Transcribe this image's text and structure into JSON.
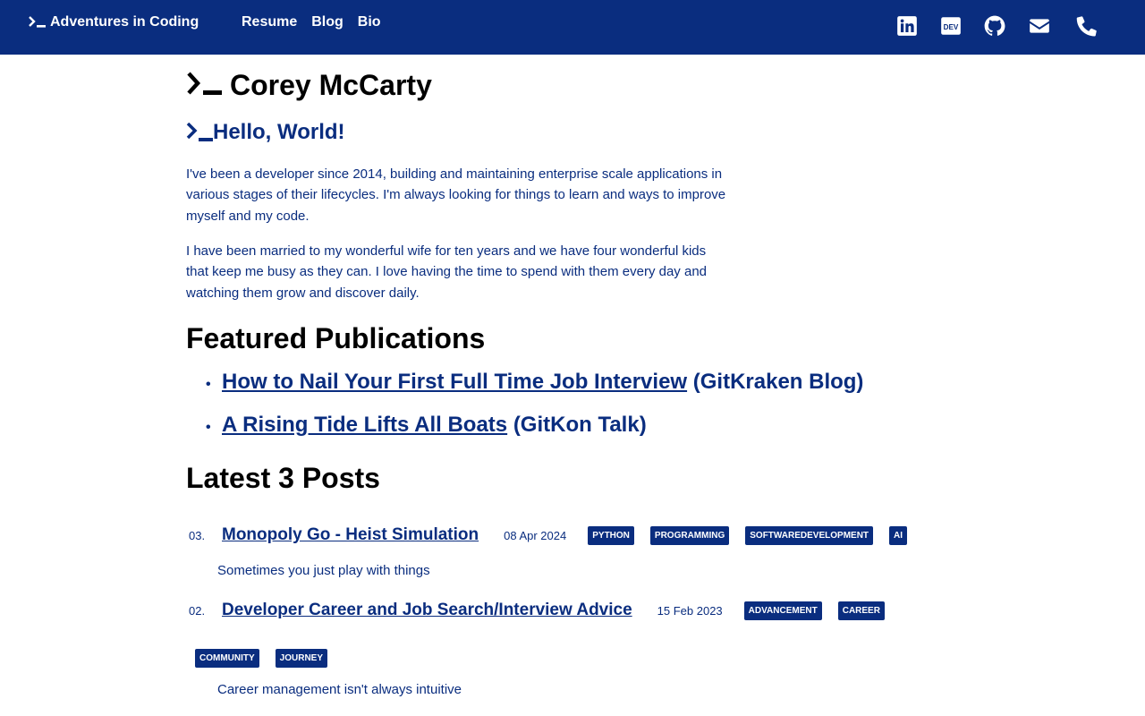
{
  "nav": {
    "brand": "Adventures in Coding",
    "links": [
      "Resume",
      "Blog",
      "Bio"
    ],
    "social": [
      "linkedin-icon",
      "dev-icon",
      "github-icon",
      "envelope-icon",
      "phone-icon"
    ],
    "dev_label": "DEV"
  },
  "colors": {
    "navy": "#0a2d7f",
    "white": "#ffffff",
    "black": "#000000"
  },
  "header": {
    "name": "Corey McCarty",
    "greeting": "Hello, World!"
  },
  "bio": {
    "p1": "I've been a developer since 2014, building and maintaining enterprise scale applications in various stages of their lifecycles. I'm always looking for things to learn and ways to improve myself and my code.",
    "p2": "I have been married to my wonderful wife for ten years and we have four wonderful kids that keep me busy as they can. I love having the time to spend with them every day and watching them grow and discover daily."
  },
  "publications": {
    "heading": "Featured Publications",
    "items": [
      {
        "title": "How to Nail Your First Full Time Job Interview",
        "source": "(GitKraken Blog)"
      },
      {
        "title": "A Rising Tide Lifts All Boats",
        "source": "(GitKon Talk)"
      }
    ]
  },
  "posts": {
    "heading": "Latest 3 Posts",
    "items": [
      {
        "num": "03.",
        "title": "Monopoly Go - Heist Simulation",
        "date": "08 Apr 2024",
        "tags": [
          "PYTHON",
          "PROGRAMMING",
          "SOFTWAREDEVELOPMENT",
          "AI"
        ],
        "desc": "Sometimes you just play with things"
      },
      {
        "num": "02.",
        "title": "Developer Career and Job Search/Interview Advice",
        "date": "15 Feb 2023",
        "tags": [
          "ADVANCEMENT",
          "CAREER"
        ],
        "tags2": [
          "COMMUNITY",
          "JOURNEY"
        ],
        "desc": "Career management isn't always intuitive"
      }
    ]
  }
}
